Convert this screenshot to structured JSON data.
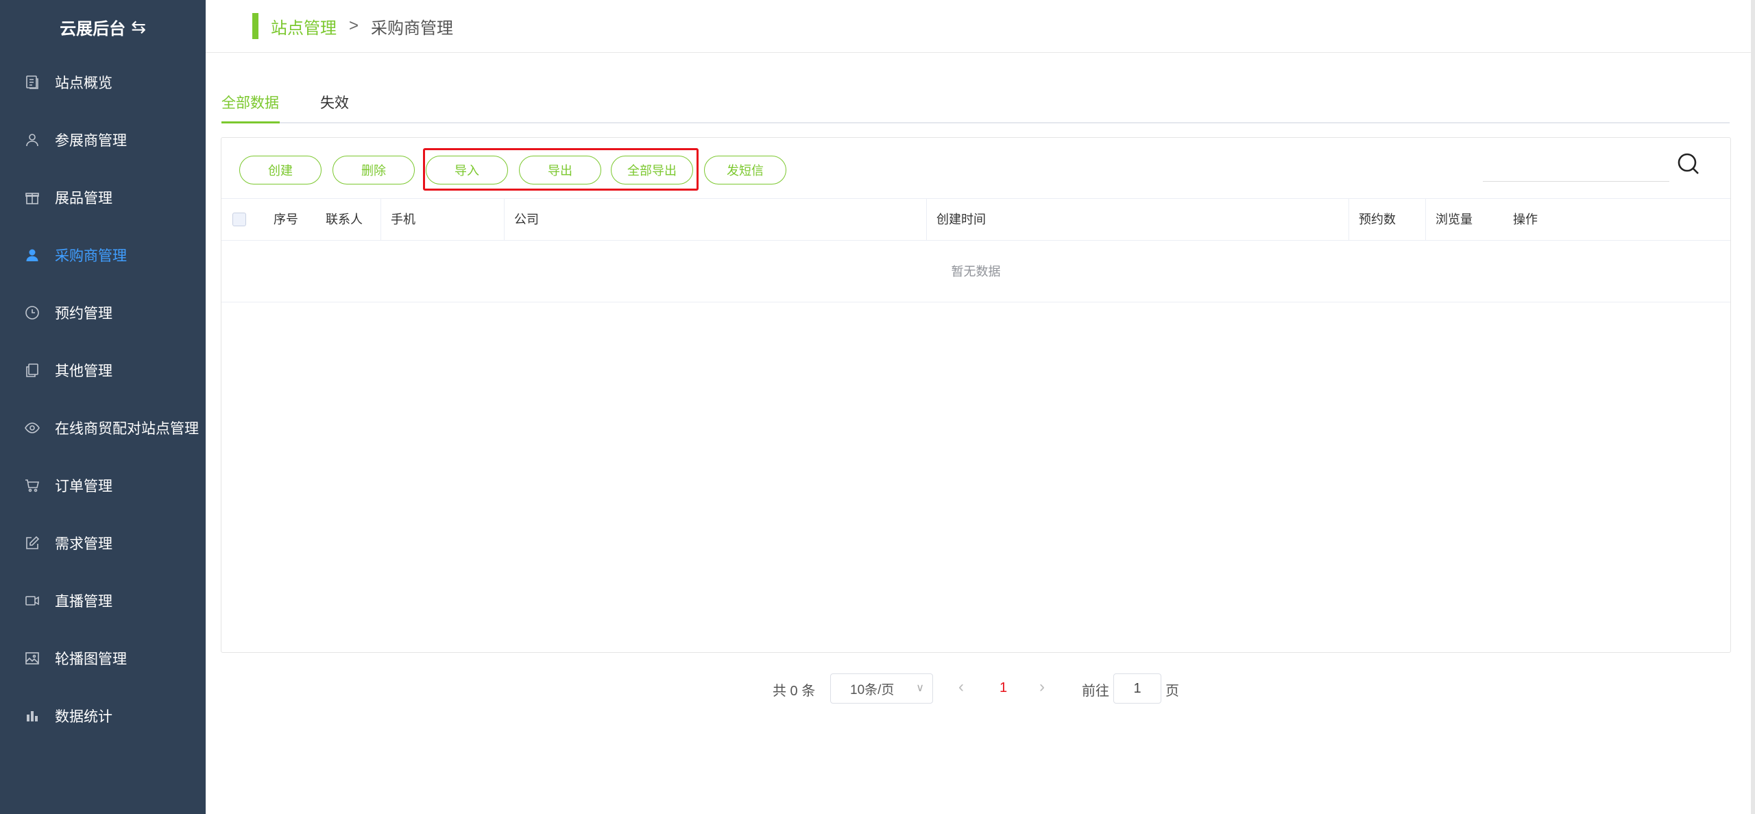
{
  "sidebar": {
    "title": "云展后台",
    "items": [
      {
        "label": "站点概览",
        "icon": "document-icon"
      },
      {
        "label": "参展商管理",
        "icon": "user-outline-icon"
      },
      {
        "label": "展品管理",
        "icon": "gift-icon"
      },
      {
        "label": "采购商管理",
        "icon": "user-filled-icon",
        "active": true
      },
      {
        "label": "预约管理",
        "icon": "clock-icon"
      },
      {
        "label": "其他管理",
        "icon": "copy-icon"
      },
      {
        "label": "在线商贸配对站点管理",
        "icon": "eye-icon"
      },
      {
        "label": "订单管理",
        "icon": "cart-icon"
      },
      {
        "label": "需求管理",
        "icon": "edit-icon"
      },
      {
        "label": "直播管理",
        "icon": "video-icon"
      },
      {
        "label": "轮播图管理",
        "icon": "picture-icon"
      },
      {
        "label": "数据统计",
        "icon": "bar-chart-icon"
      }
    ]
  },
  "breadcrumb": {
    "parent": "站点管理",
    "separator": ">",
    "current": "采购商管理"
  },
  "tabs": [
    {
      "label": "全部数据",
      "active": true
    },
    {
      "label": "失效",
      "active": false
    }
  ],
  "toolbar": {
    "create": "创建",
    "delete": "删除",
    "import": "导入",
    "export": "导出",
    "export_all": "全部导出",
    "send_sms": "发短信"
  },
  "search": {
    "placeholder": ""
  },
  "table": {
    "columns": [
      "序号",
      "联系人",
      "手机",
      "公司",
      "创建时间",
      "预约数",
      "浏览量",
      "操作"
    ],
    "empty_text": "暂无数据"
  },
  "pagination": {
    "total": "共 0 条",
    "page_size": "10条/页",
    "current_page": "1",
    "goto_prefix": "前往",
    "goto_value": "1",
    "goto_suffix": "页"
  },
  "colors": {
    "sidebar_bg": "#304156",
    "accent_green": "#7cc82f",
    "active_blue": "#409eff",
    "highlight_red": "#e8121b"
  }
}
